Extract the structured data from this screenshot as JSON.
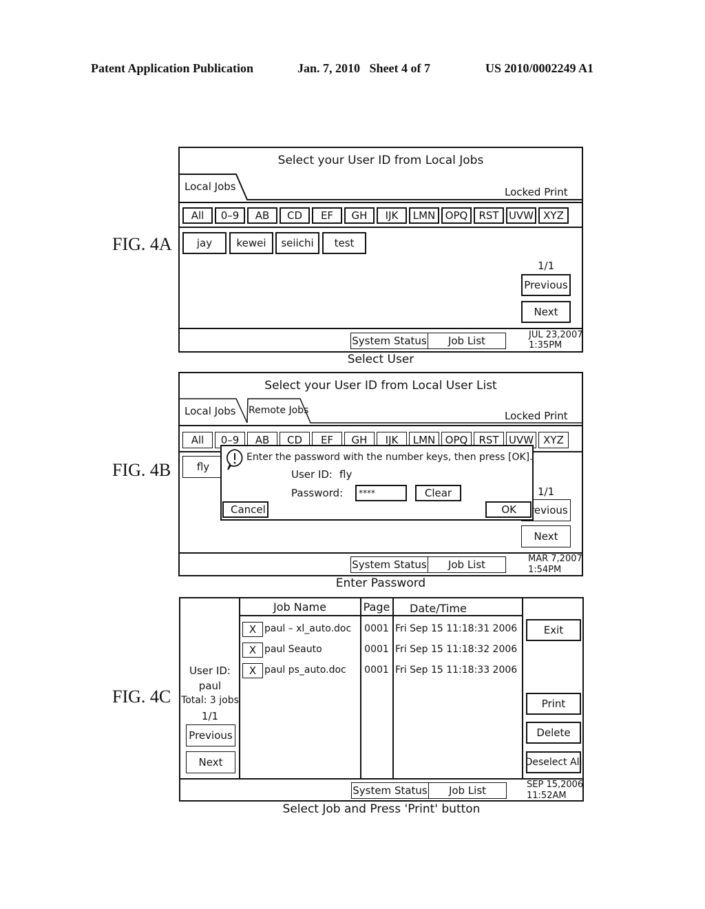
{
  "header": {
    "publication": "Patent Application Publication",
    "date_sheet": "Jan. 7, 2010   Sheet 4 of 7",
    "number": "US 2010/0002249 A1"
  },
  "fig4a": {
    "label": "FIG. 4A",
    "title": "Select your User ID from Local Jobs",
    "tabs": [
      "Local Jobs"
    ],
    "mode": "Locked Print",
    "alpha": [
      "All",
      "0–9",
      "AB",
      "CD",
      "EF",
      "GH",
      "IJK",
      "LMN",
      "OPQ",
      "RST",
      "UVW",
      "XYZ"
    ],
    "users": [
      "jay",
      "kewei",
      "seiichi",
      "test"
    ],
    "page": "1/1",
    "previous": "Previous",
    "next": "Next",
    "system_status": "System Status",
    "job_list": "Job List",
    "date": "JUL 23,2007",
    "time": "1:35PM",
    "caption": "Select User"
  },
  "fig4b": {
    "label": "FIG. 4B",
    "title": "Select your User ID from Local User List",
    "tabs": [
      "Local Jobs",
      "Remote Jobs"
    ],
    "mode": "Locked Print",
    "alpha": [
      "All",
      "0–9",
      "AB",
      "CD",
      "EF",
      "GH",
      "IJK",
      "LMN",
      "OPQ",
      "RST",
      "UVW",
      "XYZ"
    ],
    "users": [
      "fly"
    ],
    "page": "1/1",
    "previous": "Previous",
    "next": "Next",
    "dialog": {
      "message": "Enter the password with the number keys, then press [OK].",
      "user_id_label": "User ID:",
      "user_id_value": "fly",
      "password_label": "Password:",
      "password_value": "****",
      "clear": "Clear",
      "cancel": "Cancel",
      "ok": "OK"
    },
    "system_status": "System Status",
    "job_list": "Job List",
    "date": "MAR 7,2007",
    "time": "1:54PM",
    "caption": "Enter Password"
  },
  "fig4c": {
    "label": "FIG. 4C",
    "user_id_label": "User ID:",
    "user_id": "paul",
    "total": "Total: 3 jobs",
    "page": "1/1",
    "previous": "Previous",
    "next": "Next",
    "columns": [
      "Job Name",
      "Page",
      "Date/Time"
    ],
    "rows": [
      {
        "check": "X",
        "name": "paul – xl_auto.doc",
        "page": "0001",
        "datetime": "Fri Sep 15 11:18:31 2006"
      },
      {
        "check": "X",
        "name": "paul Seauto",
        "page": "0001",
        "datetime": "Fri Sep 15 11:18:32 2006"
      },
      {
        "check": "X",
        "name": "paul ps_auto.doc",
        "page": "0001",
        "datetime": "Fri Sep 15 11:18:33 2006"
      }
    ],
    "exit": "Exit",
    "print": "Print",
    "delete": "Delete",
    "deselect_all": "Deselect All",
    "system_status": "System Status",
    "job_list": "Job List",
    "date": "SEP 15,2006",
    "time": "11:52AM",
    "caption": "Select Job and Press 'Print' button"
  }
}
